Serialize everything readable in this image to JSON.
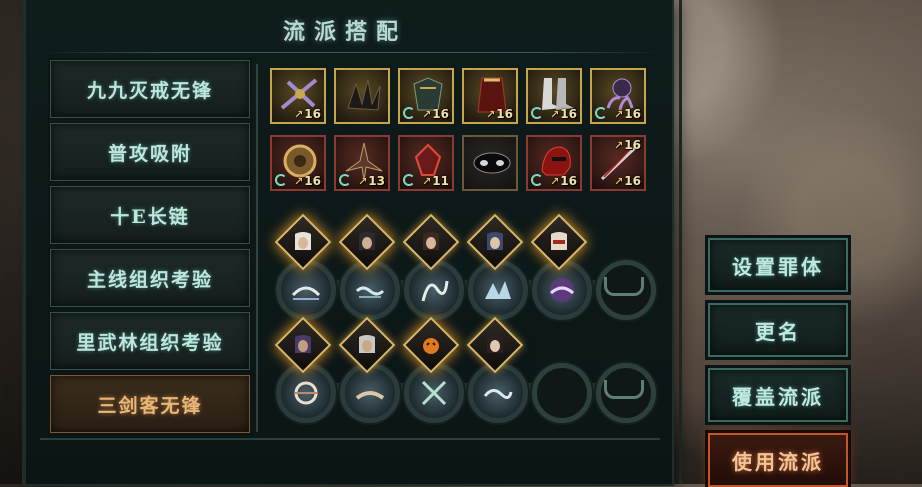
{
  "title": "流派搭配",
  "builds": [
    {
      "label": "九九灭戒无锋",
      "active": false
    },
    {
      "label": "普攻吸附",
      "active": false
    },
    {
      "label": "十E长链",
      "active": false
    },
    {
      "label": "主线组织考验",
      "active": false
    },
    {
      "label": "里武林组织考验",
      "active": false
    },
    {
      "label": "三剑客无锋",
      "active": true
    }
  ],
  "items_row1": [
    {
      "level": "16",
      "frame": "gold",
      "icon": "crossbow-icon"
    },
    {
      "level": "",
      "frame": "gold",
      "icon": "claw-gauntlet-icon"
    },
    {
      "level": "16",
      "frame": "gold",
      "icon": "dark-armor-icon"
    },
    {
      "level": "16",
      "frame": "gold",
      "icon": "red-robe-icon"
    },
    {
      "level": "16",
      "frame": "gold",
      "icon": "white-boots-icon"
    },
    {
      "level": "16",
      "frame": "gold",
      "icon": "purple-claw-icon"
    }
  ],
  "items_row2": [
    {
      "level": "16",
      "frame": "red",
      "icon": "bronze-orb-icon"
    },
    {
      "level": "13",
      "frame": "red",
      "icon": "bone-weapon-icon"
    },
    {
      "level": "11",
      "frame": "red",
      "icon": "crimson-crystal-icon"
    },
    {
      "level": "",
      "frame": "dark",
      "icon": "black-mask-icon"
    },
    {
      "level": "16",
      "frame": "red",
      "icon": "red-helmet-icon"
    },
    {
      "level": "16",
      "frame": "red",
      "icon": "twin-sword-icon",
      "extra_level": "16"
    }
  ],
  "team1": {
    "portraits": [
      "white-hair-hero-icon",
      "dark-robe-hero-icon",
      "swordsman-hero-icon",
      "blue-hair-hero-icon",
      "masked-hero-icon"
    ],
    "slots": [
      "bridge-skill-icon",
      "water-skill-icon",
      "ribbon-skill-icon",
      "wave-skill-icon",
      "purple-storm-skill-icon",
      "empty-slot-icon"
    ]
  },
  "team2": {
    "portraits": [
      "jade-hero-icon",
      "elder-hero-icon",
      "pumpkin-hero-icon",
      "scholar-hero-icon"
    ],
    "slots": [
      "ring-skill-icon",
      "dust-skill-icon",
      "cross-blade-skill-icon",
      "mist-skill-icon",
      "empty-ring-icon",
      "empty-slot-icon"
    ]
  },
  "actions": {
    "set_body": "设置罪体",
    "rename": "更名",
    "overwrite": "覆盖流派",
    "use": "使用流派"
  },
  "colors": {
    "accent_teal": "#bfe6dc",
    "accent_orange": "#c0582a",
    "gold_frame": "#c7a64a",
    "red_frame": "#8a3b2f"
  }
}
